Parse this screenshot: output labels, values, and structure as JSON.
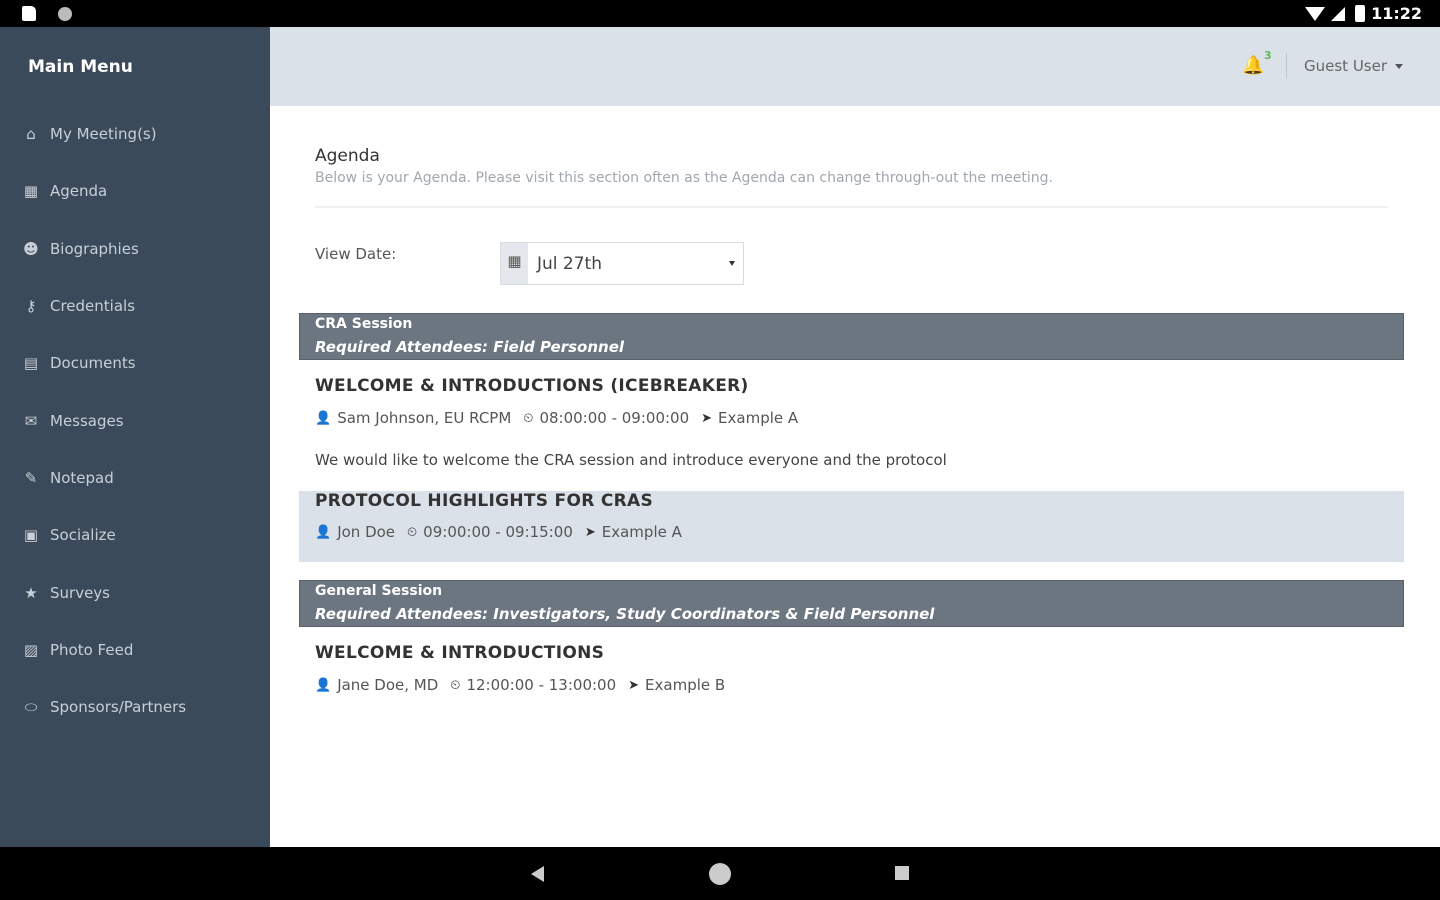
{
  "status_bar": {
    "time": "11:22"
  },
  "sidebar": {
    "title": "Main Menu",
    "items": [
      {
        "label": "My Meeting(s)",
        "icon": "⌂"
      },
      {
        "label": "Agenda",
        "icon": "▦"
      },
      {
        "label": "Biographies",
        "icon": "☻"
      },
      {
        "label": "Credentials",
        "icon": "⚷"
      },
      {
        "label": "Documents",
        "icon": "▤"
      },
      {
        "label": "Messages",
        "icon": "✉"
      },
      {
        "label": "Notepad",
        "icon": "✎"
      },
      {
        "label": "Socialize",
        "icon": "▣"
      },
      {
        "label": "Surveys",
        "icon": "★"
      },
      {
        "label": "Photo Feed",
        "icon": "▨"
      },
      {
        "label": "Sponsors/Partners",
        "icon": "⬭"
      }
    ]
  },
  "header": {
    "notification_count": "3",
    "user_label": "Guest User"
  },
  "page": {
    "title": "Agenda",
    "subtitle": "Below is your Agenda. Please visit this section often as the Agenda can change through-out the meeting.",
    "view_date_label": "View Date:",
    "selected_date": "Jul 27th"
  },
  "sessions": [
    {
      "name": "CRA Session",
      "attendees": "Required Attendees: Field Personnel",
      "items": [
        {
          "title": "WELCOME & INTRODUCTIONS (ICEBREAKER)",
          "speaker": "Sam Johnson, EU RCPM",
          "time": "08:00:00 - 09:00:00",
          "location": "Example A",
          "description": "We would like to welcome the CRA session and introduce everyone and the protocol"
        },
        {
          "title": "PROTOCOL HIGHLIGHTS FOR CRAS",
          "speaker": "Jon Doe",
          "time": "09:00:00 - 09:15:00",
          "location": "Example A"
        }
      ]
    },
    {
      "name": "General Session",
      "attendees": "Required Attendees: Investigators, Study Coordinators & Field Personnel",
      "items": [
        {
          "title": "WELCOME & INTRODUCTIONS",
          "speaker": "Jane Doe, MD",
          "time": "12:00:00 - 13:00:00",
          "location": "Example B"
        }
      ]
    }
  ],
  "icons": {
    "user": "👤",
    "clock": "⏲",
    "location": "➤",
    "calendar": "▦",
    "bell": "🔔"
  },
  "colors": {
    "sidebar_bg": "#3a4a5a",
    "header_bg": "#dbe1e8",
    "session_header_bg": "#6b7680",
    "badge_green": "#5cb85c"
  }
}
